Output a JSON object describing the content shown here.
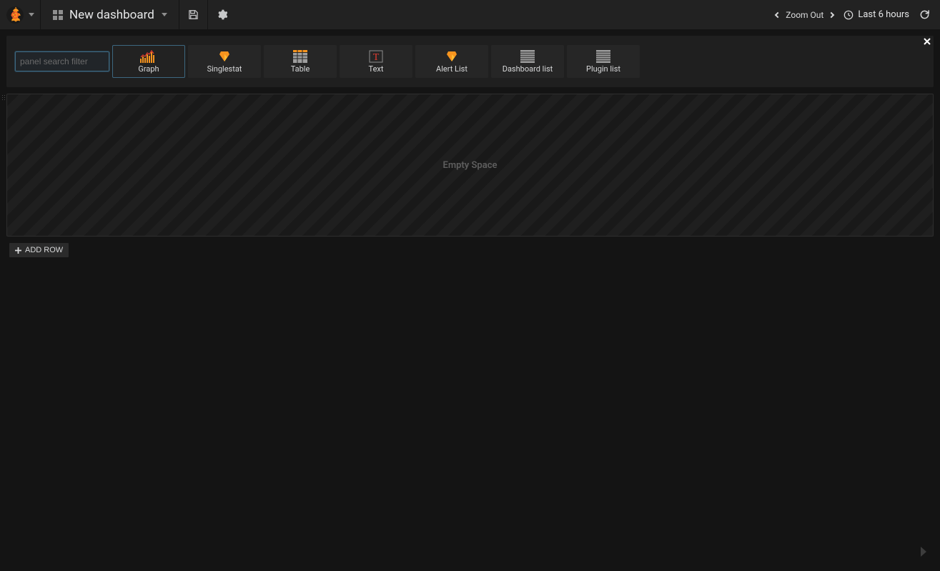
{
  "header": {
    "dashboard_title": "New dashboard",
    "zoom_out_label": "Zoom Out",
    "time_range_label": "Last 6 hours"
  },
  "picker": {
    "search_placeholder": "panel search filter",
    "panels": [
      {
        "id": "graph",
        "label": "Graph",
        "selected": true
      },
      {
        "id": "singlestat",
        "label": "Singlestat",
        "selected": false
      },
      {
        "id": "table",
        "label": "Table",
        "selected": false
      },
      {
        "id": "text",
        "label": "Text",
        "selected": false
      },
      {
        "id": "alertlist",
        "label": "Alert List",
        "selected": false
      },
      {
        "id": "dashboardlist",
        "label": "Dashboard list",
        "selected": false
      },
      {
        "id": "pluginlist",
        "label": "Plugin list",
        "selected": false
      }
    ]
  },
  "main": {
    "empty_space_label": "Empty Space",
    "add_row_label": "ADD ROW"
  }
}
